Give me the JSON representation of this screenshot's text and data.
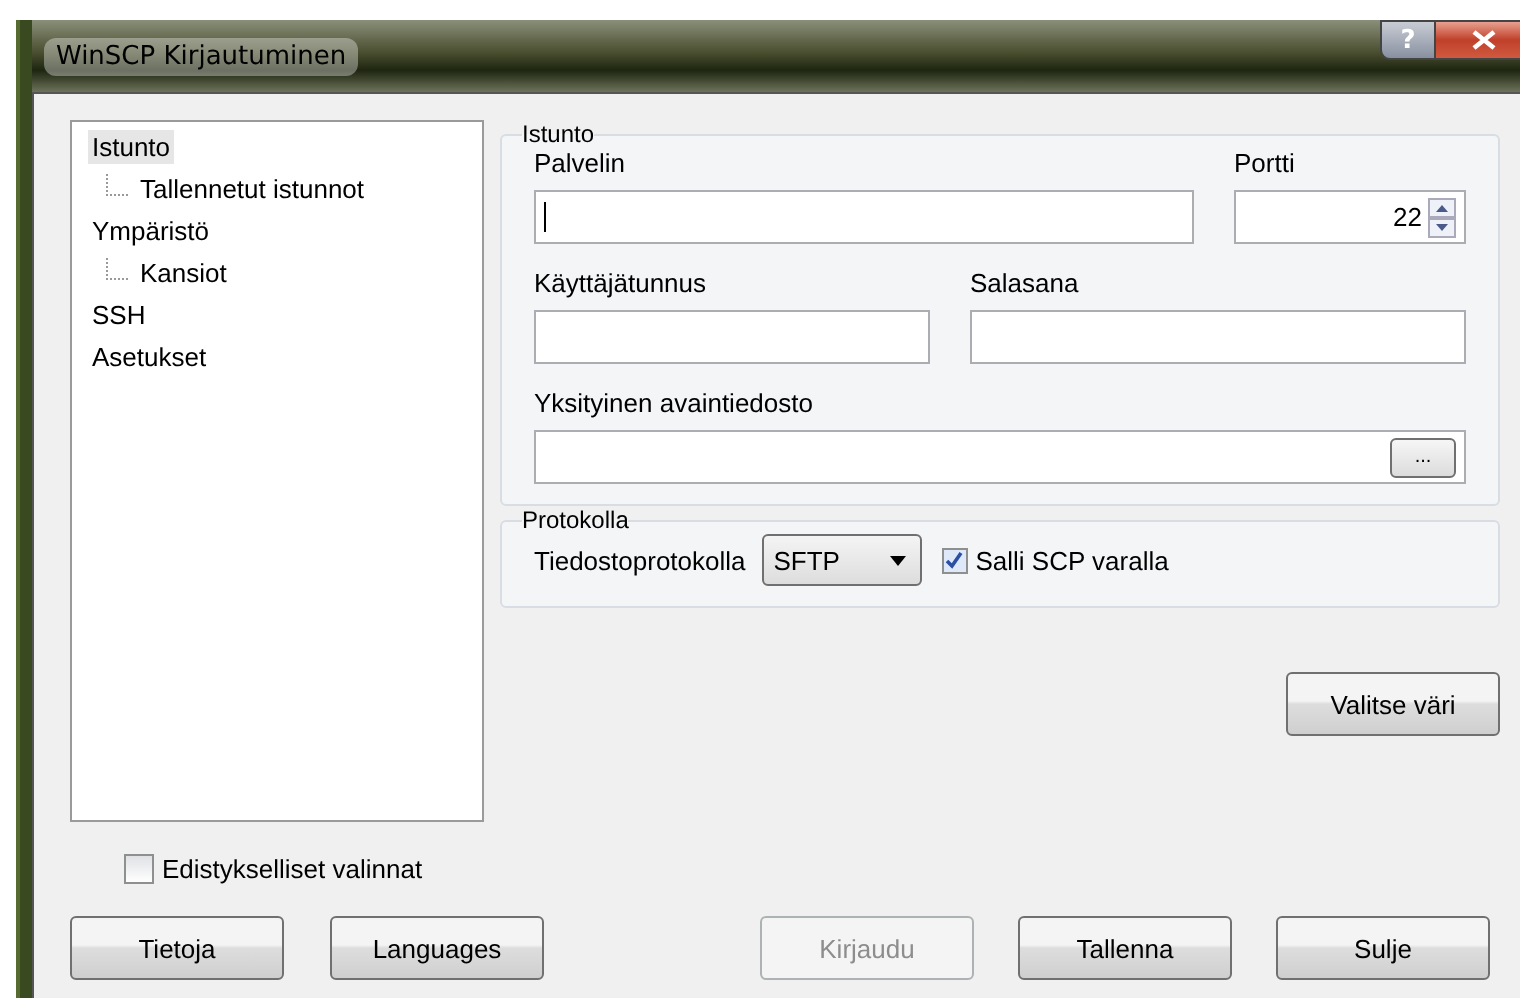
{
  "window": {
    "title": "WinSCP Kirjautuminen",
    "help_button": "?"
  },
  "tree": [
    {
      "label": "Istunto",
      "selected": true,
      "children": [
        {
          "label": "Tallennetut istunnot",
          "selected": false
        }
      ]
    },
    {
      "label": "Ympäristö",
      "selected": false,
      "children": [
        {
          "label": "Kansiot",
          "selected": false
        }
      ]
    },
    {
      "label": "SSH",
      "selected": false
    },
    {
      "label": "Asetukset",
      "selected": false
    }
  ],
  "session": {
    "title": "Istunto",
    "host": {
      "label": "Palvelin",
      "focused": true
    },
    "port": {
      "label": "Portti",
      "value": "22"
    },
    "user": {
      "label": "Käyttäjätunnus"
    },
    "password": {
      "label": "Salasana"
    },
    "key_file": {
      "label": "Yksityinen avaintiedosto",
      "browse": "..."
    }
  },
  "protocol": {
    "title": "Protokolla",
    "label": "Tiedostoprotokolla",
    "value": "SFTP",
    "fallback": {
      "label": "Salli SCP varalla",
      "checked": true
    }
  },
  "color_button": "Valitse väri",
  "advanced": {
    "label": "Edistykselliset valinnat",
    "checked": false
  },
  "buttons": [
    {
      "label": "Tietoja",
      "disabled": false
    },
    {
      "label": "Languages",
      "disabled": false
    },
    {
      "label": "Kirjaudu",
      "disabled": true
    },
    {
      "label": "Tallenna",
      "disabled": false
    },
    {
      "label": "Sulje",
      "disabled": false
    }
  ]
}
